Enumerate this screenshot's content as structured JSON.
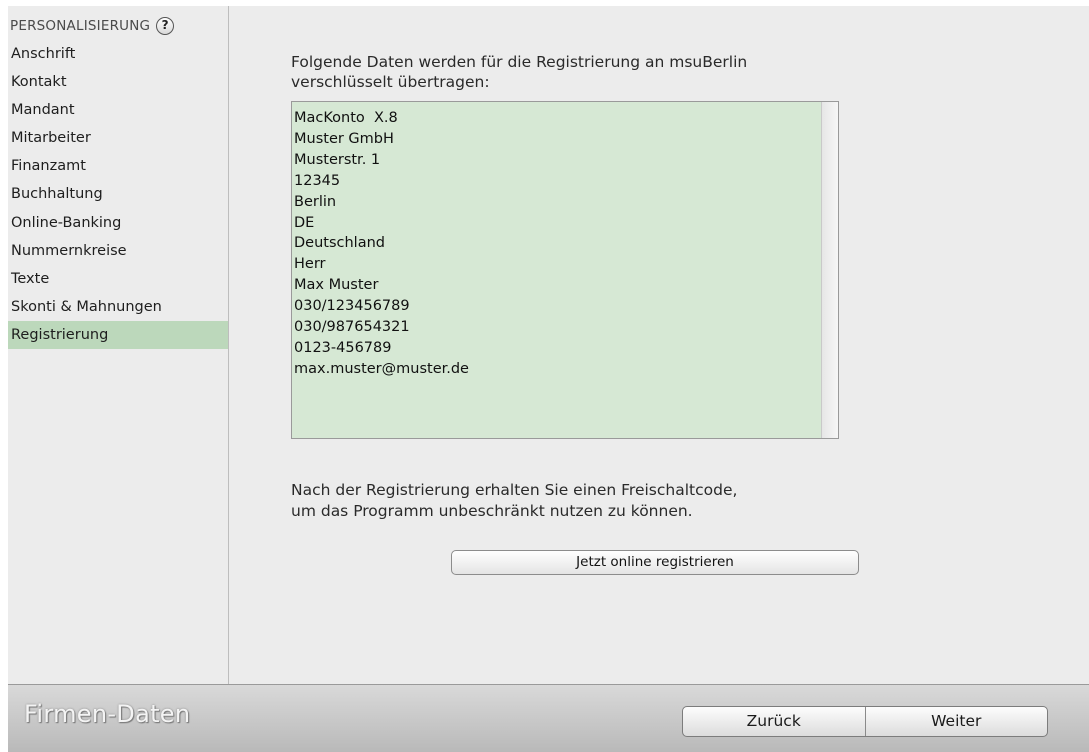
{
  "sidebar": {
    "header": "PERSONALISIERUNG",
    "help_glyph": "?",
    "items": [
      {
        "label": "Anschrift",
        "active": false
      },
      {
        "label": "Kontakt",
        "active": false
      },
      {
        "label": "Mandant",
        "active": false
      },
      {
        "label": "Mitarbeiter",
        "active": false
      },
      {
        "label": "Finanzamt",
        "active": false
      },
      {
        "label": "Buchhaltung",
        "active": false
      },
      {
        "label": "Online-Banking",
        "active": false
      },
      {
        "label": "Nummernkreise",
        "active": false
      },
      {
        "label": "Texte",
        "active": false
      },
      {
        "label": "Skonti & Mahnungen",
        "active": false
      },
      {
        "label": "Registrierung",
        "active": true
      }
    ]
  },
  "main": {
    "intro_line1": "Folgende Daten werden für die Registrierung an msuBerlin",
    "intro_line2": "verschlüsselt übertragen:",
    "data_lines": [
      "MacKonto  X.8",
      "Muster GmbH",
      "Musterstr. 1",
      "12345",
      "Berlin",
      "DE",
      "Deutschland",
      "Herr",
      "Max Muster",
      "030/123456789",
      "030/987654321",
      "0123-456789",
      "max.muster@muster.de"
    ],
    "info_line1": "Nach der Registrierung erhalten Sie einen Freischaltcode,",
    "info_line2": "um das Programm unbeschränkt nutzen zu können.",
    "register_button": "Jetzt online registrieren"
  },
  "bottom": {
    "brand": "Firmen-Daten",
    "back_button": "Zurück",
    "next_button": "Weiter"
  },
  "colors": {
    "active_item_bg": "#bcd8bb",
    "data_box_bg": "#d6e8d4"
  }
}
